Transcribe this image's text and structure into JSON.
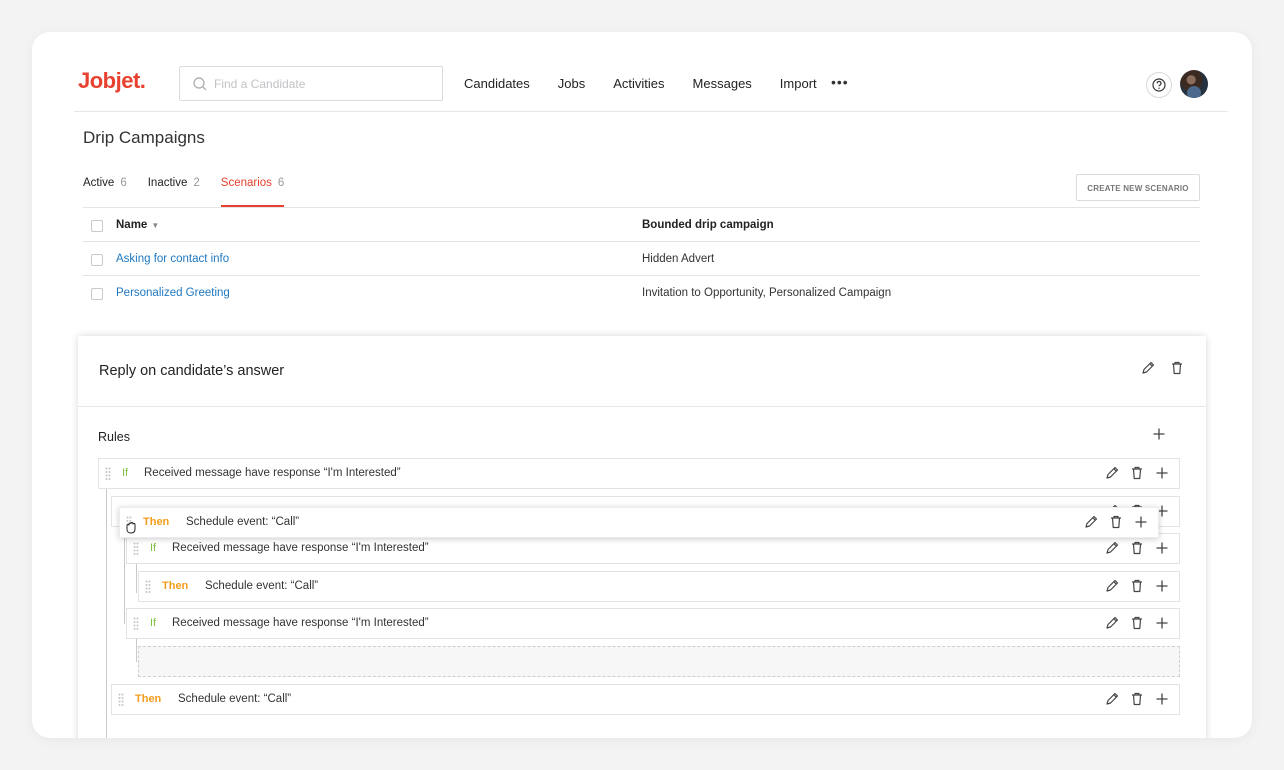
{
  "app": {
    "logo": "Jobjet."
  },
  "search": {
    "placeholder": "Find a Candidate"
  },
  "nav": {
    "items": [
      "Candidates",
      "Jobs",
      "Activities",
      "Messages",
      "Import"
    ],
    "more": "•••"
  },
  "page": {
    "title": "Drip Campaigns"
  },
  "tabs": [
    {
      "label": "Active",
      "count": "6"
    },
    {
      "label": "Inactive",
      "count": "2"
    },
    {
      "label": "Scenarios",
      "count": "6",
      "active": true
    }
  ],
  "create_button": "CREATE NEW SCENARIO",
  "table": {
    "headers": {
      "name": "Name",
      "sort": "▼",
      "bounded": "Bounded drip campaign"
    },
    "rows": [
      {
        "name": "Asking for contact info",
        "bounded": "Hidden Advert"
      },
      {
        "name": "Personalized Greeting",
        "bounded": "Invitation to Opportunity, Personalized Campaign"
      }
    ]
  },
  "modal": {
    "title": "Reply on candidate’s answer",
    "rules_label": "Rules",
    "rules": [
      {
        "kw": "If",
        "text": "Received message have response “I'm Interested”"
      },
      {
        "kw": "",
        "text": ""
      },
      {
        "kw": "If",
        "text": "Received message have response “I'm Interested”"
      },
      {
        "kw": "Then",
        "text": "Schedule event: “Call”"
      },
      {
        "kw": "If",
        "text": "Received message have response “I'm Interested”"
      },
      {
        "kw": "Then",
        "text": "Schedule event: “Call”"
      }
    ],
    "dragging": {
      "kw": "Then",
      "text": "Schedule event: “Call”"
    }
  },
  "colors": {
    "brand": "#e8412f",
    "link": "#1f78c1",
    "if": "#7fbf3f",
    "then": "#f49d1c"
  }
}
